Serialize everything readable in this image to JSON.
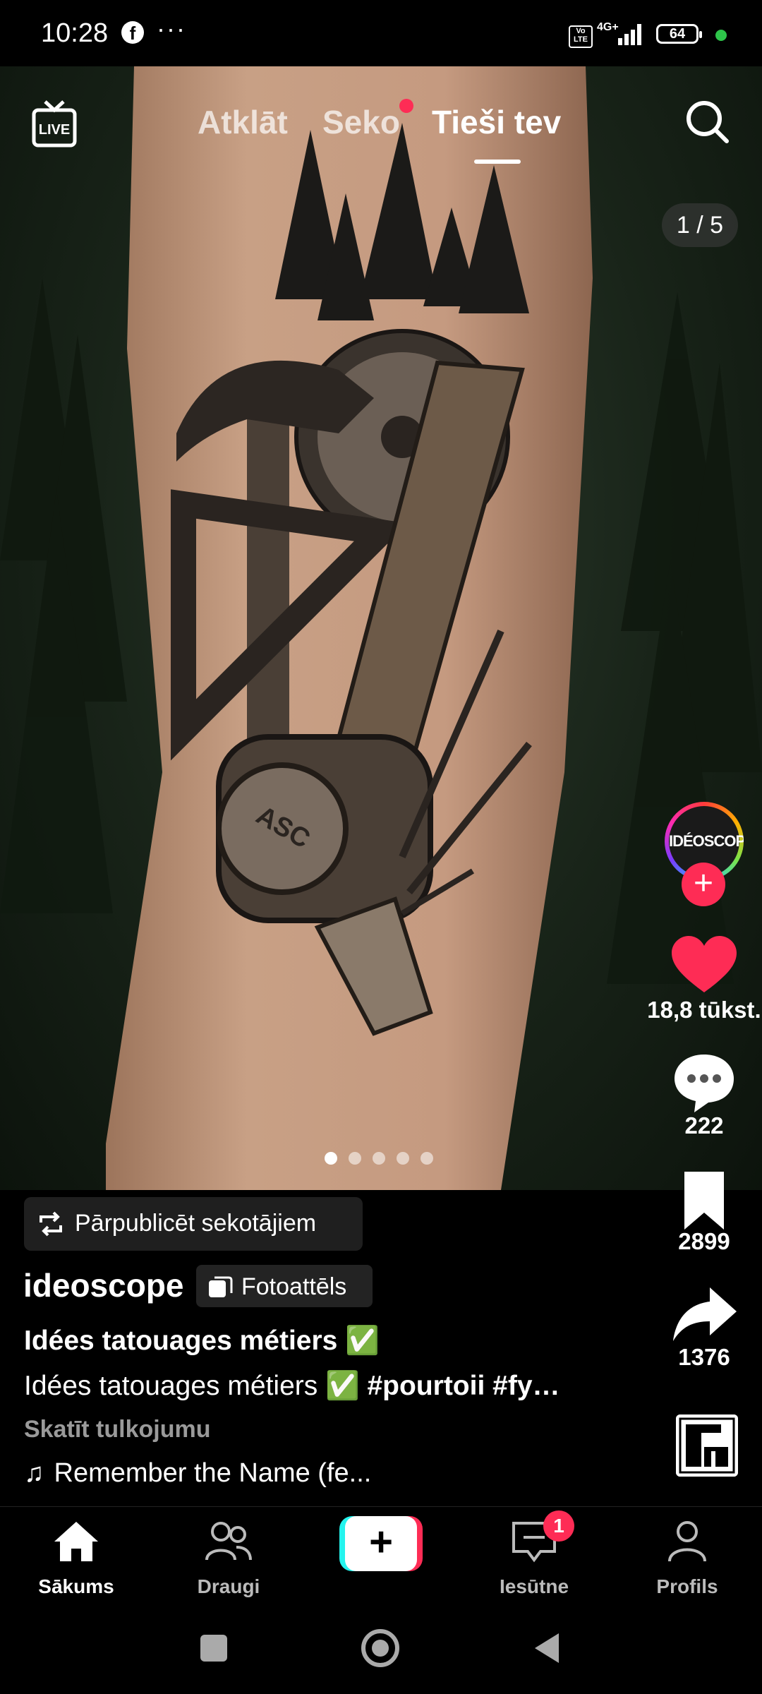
{
  "status_bar": {
    "time": "10:28",
    "app_icon": "facebook-icon",
    "overflow": "···",
    "volte": "Vo LTE",
    "network": "4G+",
    "battery": "64"
  },
  "top_nav": {
    "tabs": [
      {
        "label": "Atklāt"
      },
      {
        "label": "Seko"
      },
      {
        "label": "Tieši tev"
      }
    ],
    "active_tab": "Tieši tev"
  },
  "post": {
    "page_counter": "1 / 5",
    "slides_total": 5,
    "slide_active": 1,
    "image_description": "tattoo-forearm-tools"
  },
  "actions": {
    "avatar_label": "IDÉOSCOPE",
    "likes": "18,8 tūkst.",
    "comments": "222",
    "saves": "2899",
    "shares": "1376",
    "like_color": "#fe2c55"
  },
  "caption": {
    "repost_label": "Pārpublicēt sekotājiem",
    "username": "ideoscope",
    "content_type": "Fotoattēls",
    "title": "Idées tatouages métiers ✅",
    "body_text": "Idées tatouages métiers ✅ ",
    "body_tags": "#pourtoii #fy…",
    "translate": "Skatīt tulkojumu",
    "music": "Remember the Name (fe..."
  },
  "bottom_nav": {
    "home": "Sākums",
    "friends": "Draugi",
    "create": "+",
    "inbox": "Iesūtne",
    "inbox_badge": "1",
    "profile": "Profils"
  }
}
